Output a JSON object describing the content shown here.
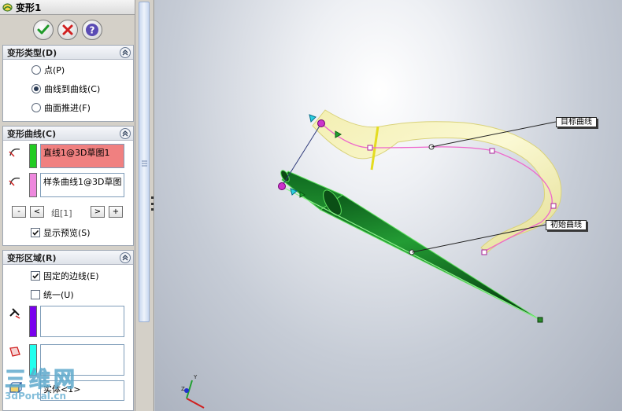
{
  "panel": {
    "title": "变形1",
    "title_icon": "deform-feature-icon",
    "actions": {
      "ok": "ok-check-icon",
      "cancel": "cancel-x-icon",
      "help": "help-question-icon"
    }
  },
  "deform_type": {
    "header": "变形类型(D)",
    "options": [
      {
        "label": "点(P)",
        "selected": false
      },
      {
        "label": "曲线到曲线(C)",
        "selected": true
      },
      {
        "label": "曲面推进(F)",
        "selected": false
      }
    ]
  },
  "deform_curves": {
    "header": "变形曲线(C)",
    "initial_curve": {
      "value": "直线1@3D草图1",
      "color": "#22cc22",
      "box_color": "#f08080"
    },
    "target_curve": {
      "value": "样条曲线1@3D草图",
      "color": "#ee88dd"
    },
    "group_nav": {
      "minus": "-",
      "prev": "<",
      "label": "组[1]",
      "next": ">",
      "plus": "+"
    },
    "show_preview": {
      "label": "显示预览(S)",
      "checked": true
    }
  },
  "deform_region": {
    "header": "变形区域(R)",
    "fixed_edges": {
      "label": "固定的边线(E)",
      "checked": true
    },
    "uniform": {
      "label": "统一(U)",
      "checked": false
    },
    "fixed_edges_color": "#7a00ee",
    "extra_faces_color": "#22ffee",
    "bodies_value": "实体<1>"
  },
  "viewport": {
    "callout_target": "目标曲线",
    "callout_initial": "初始曲线",
    "body_color": "#1a8a2a",
    "preview_color": "#f5f3b0",
    "curve_color": "#ee66cc"
  },
  "watermark": {
    "big": "三维网",
    "small": "3dPortal.cn"
  }
}
